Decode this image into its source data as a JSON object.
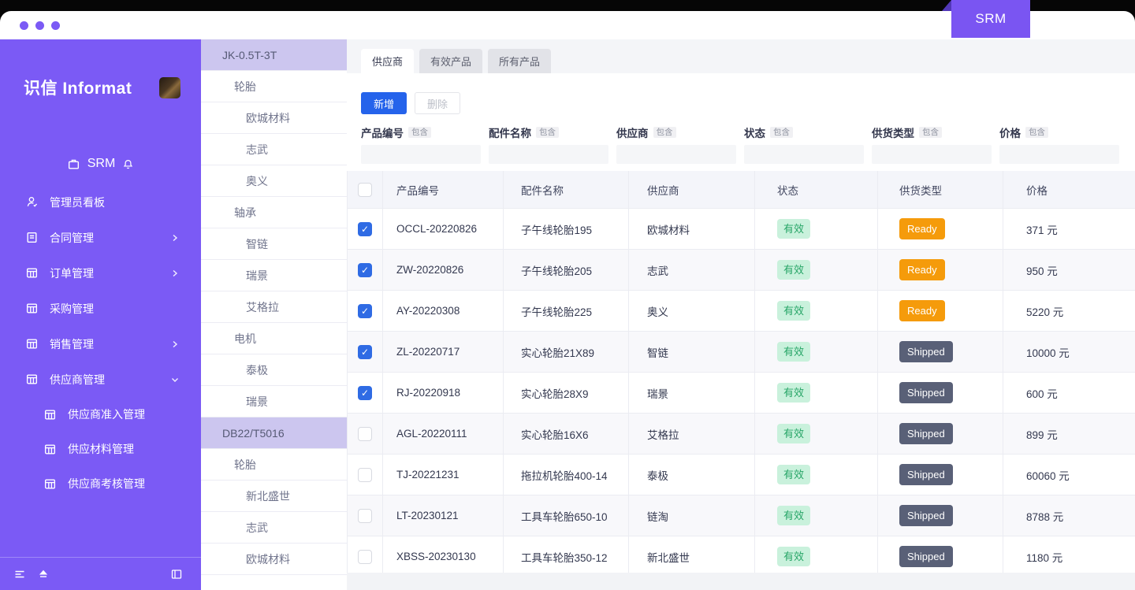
{
  "window": {
    "ribbon_label": "SRM"
  },
  "icons": {
    "check": "✓"
  },
  "colors": {
    "sidebar_purple": "#7b5af5",
    "tree_active_bg": "#ccc6ef",
    "primary_blue": "#2563eb",
    "checkbox_blue": "#2f6be4",
    "status_green_bg": "#c9f1dc",
    "status_green_text": "#27a567",
    "ready_orange": "#f59b0b",
    "shipped_slate": "#596077"
  },
  "sidebar": {
    "logo": "识信 Informat",
    "workspace_label": "SRM",
    "menu": [
      {
        "label": "管理员看板",
        "chevron": "none"
      },
      {
        "label": "合同管理",
        "chevron": "right"
      },
      {
        "label": "订单管理",
        "chevron": "right"
      },
      {
        "label": "采购管理",
        "chevron": "none"
      },
      {
        "label": "销售管理",
        "chevron": "right"
      },
      {
        "label": "供应商管理",
        "chevron": "down"
      }
    ],
    "submenu": [
      {
        "label": "供应商准入管理"
      },
      {
        "label": "供应材料管理"
      },
      {
        "label": "供应商考核管理"
      }
    ]
  },
  "tree": {
    "items": [
      {
        "label": "JK-0.5T-3T"
      },
      {
        "label": "轮胎"
      },
      {
        "label": "欧城材料"
      },
      {
        "label": "志武"
      },
      {
        "label": "奥义"
      },
      {
        "label": "轴承"
      },
      {
        "label": "智链"
      },
      {
        "label": "瑞景"
      },
      {
        "label": "艾格拉"
      },
      {
        "label": "电机"
      },
      {
        "label": "泰极"
      },
      {
        "label": "瑞景"
      },
      {
        "label": "DB22/T5016"
      },
      {
        "label": "轮胎"
      },
      {
        "label": "新北盛世"
      },
      {
        "label": "志武"
      },
      {
        "label": "欧城材料"
      }
    ]
  },
  "main": {
    "tabs": [
      {
        "label": "供应商"
      },
      {
        "label": "有效产品"
      },
      {
        "label": "所有产品"
      }
    ],
    "toolbar": {
      "add_label": "新增",
      "delete_label": "删除"
    },
    "filters": [
      {
        "label": "产品编号",
        "op": "包含",
        "value": ""
      },
      {
        "label": "配件名称",
        "op": "包含",
        "value": ""
      },
      {
        "label": "供应商",
        "op": "包含",
        "value": ""
      },
      {
        "label": "状态",
        "op": "包含",
        "value": ""
      },
      {
        "label": "供货类型",
        "op": "包含",
        "value": ""
      },
      {
        "label": "价格",
        "op": "包含",
        "value": ""
      }
    ],
    "table": {
      "columns": [
        "产品编号",
        "配件名称",
        "供应商",
        "状态",
        "供货类型",
        "价格"
      ],
      "rows": [
        {
          "code": "OCCL-20220826",
          "part": "子午线轮胎195",
          "supplier": "欧城材料",
          "status": "有效",
          "type": "Ready",
          "price": "371 元"
        },
        {
          "code": "ZW-20220826",
          "part": "子午线轮胎205",
          "supplier": "志武",
          "status": "有效",
          "type": "Ready",
          "price": "950 元"
        },
        {
          "code": "AY-20220308",
          "part": "子午线轮胎225",
          "supplier": "奥义",
          "status": "有效",
          "type": "Ready",
          "price": "5220 元"
        },
        {
          "code": "ZL-20220717",
          "part": "实心轮胎21X89",
          "supplier": "智链",
          "status": "有效",
          "type": "Shipped",
          "price": "10000 元"
        },
        {
          "code": "RJ-20220918",
          "part": "实心轮胎28X9",
          "supplier": "瑞景",
          "status": "有效",
          "type": "Shipped",
          "price": "600 元"
        },
        {
          "code": "AGL-20220111",
          "part": "实心轮胎16X6",
          "supplier": "艾格拉",
          "status": "有效",
          "type": "Shipped",
          "price": "899 元"
        },
        {
          "code": "TJ-20221231",
          "part": "拖拉机轮胎400-14",
          "supplier": "泰极",
          "status": "有效",
          "type": "Shipped",
          "price": "60060 元"
        },
        {
          "code": "LT-20230121",
          "part": "工具车轮胎650-10",
          "supplier": "链淘",
          "status": "有效",
          "type": "Shipped",
          "price": "8788 元"
        },
        {
          "code": "XBSS-20230130",
          "part": "工具车轮胎350-12",
          "supplier": "新北盛世",
          "status": "有效",
          "type": "Shipped",
          "price": "1180 元"
        }
      ]
    }
  }
}
